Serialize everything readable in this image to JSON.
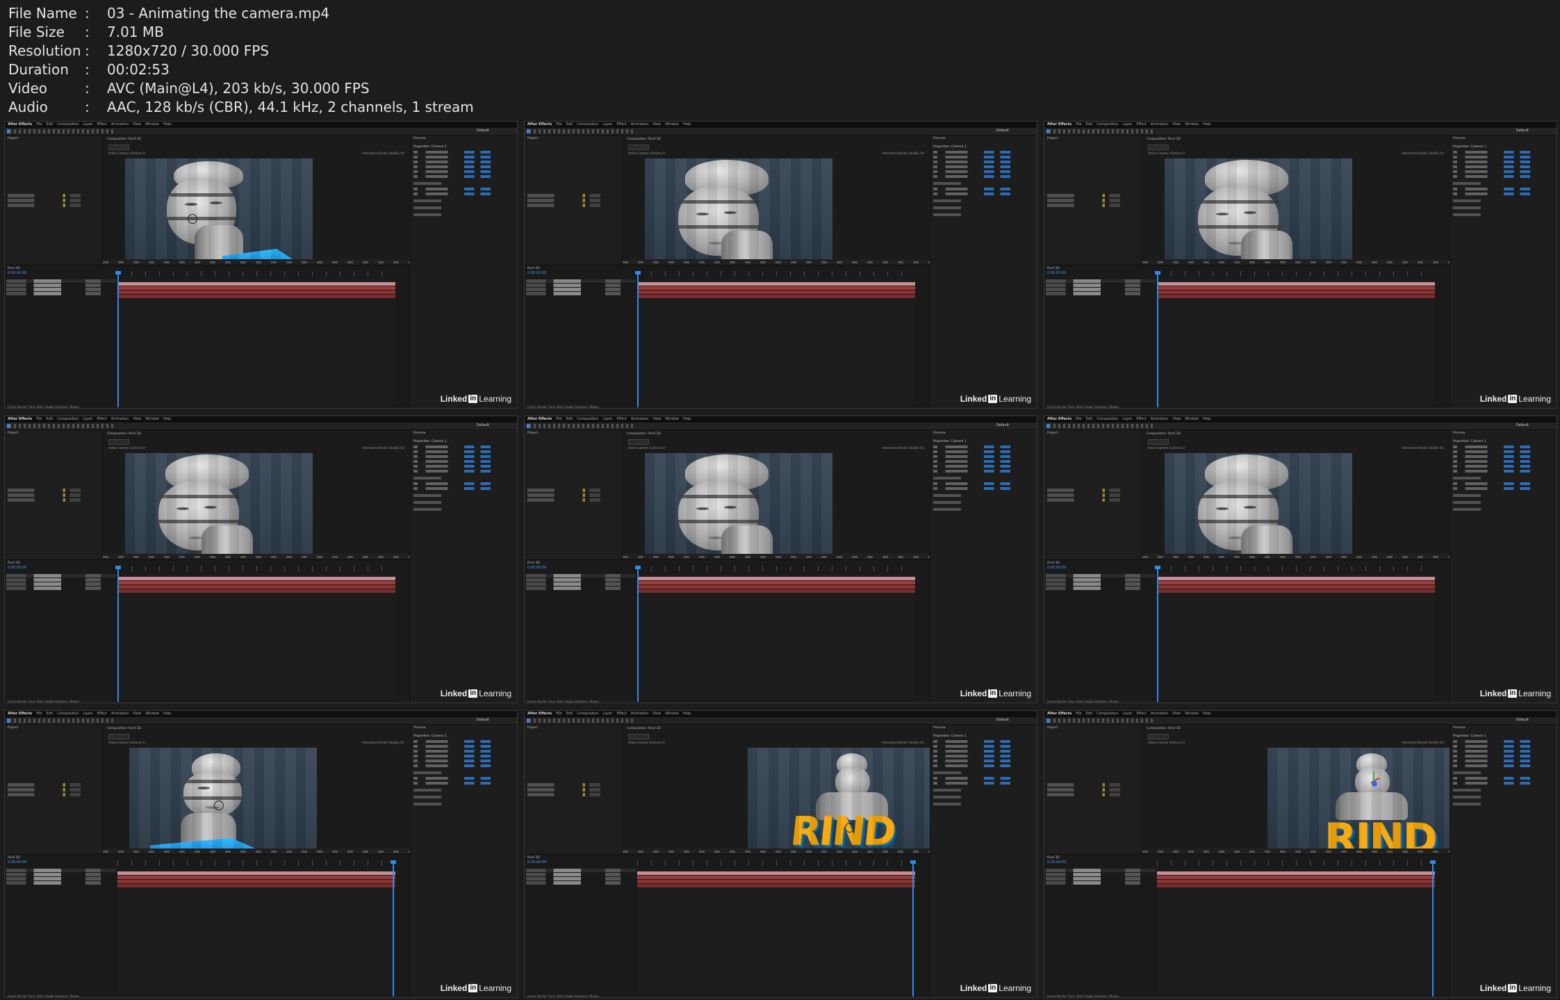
{
  "file_info": [
    {
      "key": "File Name",
      "value": "03 - Animating the camera.mp4"
    },
    {
      "key": "File Size",
      "value": "7.01 MB"
    },
    {
      "key": "Resolution",
      "value": "1280x720 / 30.000 FPS"
    },
    {
      "key": "Duration",
      "value": "00:02:53"
    },
    {
      "key": "Video",
      "value": "AVC (Main@L4), 203 kb/s, 30.000 FPS"
    },
    {
      "key": "Audio",
      "value": "AAC, 128 kb/s (CBR), 44.1 kHz, 2 channels, 1 stream"
    }
  ],
  "separator": ":",
  "app": {
    "menu": [
      "After Effects",
      "File",
      "Edit",
      "Composition",
      "Layer",
      "Effect",
      "Animation",
      "View",
      "Window",
      "Help"
    ],
    "workspace": "Default",
    "project_tab": "Project",
    "comp_tab": "Composition: Rind 3D",
    "active_camera": "Active Camera (Camera 1)",
    "render_quality": "Interactive Render Quality: On",
    "props_tab": "Properties: Camera 1",
    "timeline_tab": "Rind 3D",
    "timecode": "0:00:00:00",
    "footer": "Frame Render Time: 40ms   Toggle Switches / Modes",
    "watermark_brand": "Linked",
    "watermark_in": "in",
    "watermark_product": "Learning"
  },
  "frames": [
    {
      "scene": "statue-close",
      "cti": 0.0
    },
    {
      "scene": "statue-close",
      "cti": 0.0
    },
    {
      "scene": "statue-close",
      "cti": 0.0
    },
    {
      "scene": "statue-angle",
      "cti": 0.0
    },
    {
      "scene": "statue-angle",
      "cti": 0.0
    },
    {
      "scene": "statue-angle",
      "cti": 0.0
    },
    {
      "scene": "statue-far",
      "cti": 1.0
    },
    {
      "scene": "rind",
      "cti": 1.0,
      "rind_text": "RIND"
    },
    {
      "scene": "rind",
      "cti": 1.0,
      "rind_text": "RIND"
    }
  ],
  "colors": {
    "accent": "#2d8ceb",
    "rind_text": "#f6a80d",
    "plate": "#1c9fee"
  }
}
